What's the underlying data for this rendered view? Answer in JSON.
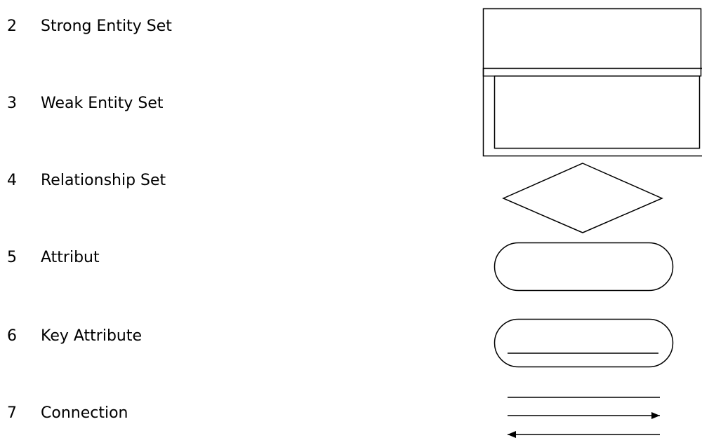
{
  "legend": {
    "items": [
      {
        "number": "2",
        "label": "Strong Entity Set",
        "symbol": "rectangle"
      },
      {
        "number": "3",
        "label": "Weak Entity Set",
        "symbol": "double-rectangle"
      },
      {
        "number": "4",
        "label": "Relationship Set",
        "symbol": "diamond"
      },
      {
        "number": "5",
        "label": "Attribut",
        "symbol": "ellipse"
      },
      {
        "number": "6",
        "label": "Key Attribute",
        "symbol": "underlined-ellipse"
      },
      {
        "number": "7",
        "label": "Connection",
        "symbol": "lines-and-arrows"
      }
    ]
  },
  "colors": {
    "stroke": "#000000",
    "background": "#ffffff"
  }
}
